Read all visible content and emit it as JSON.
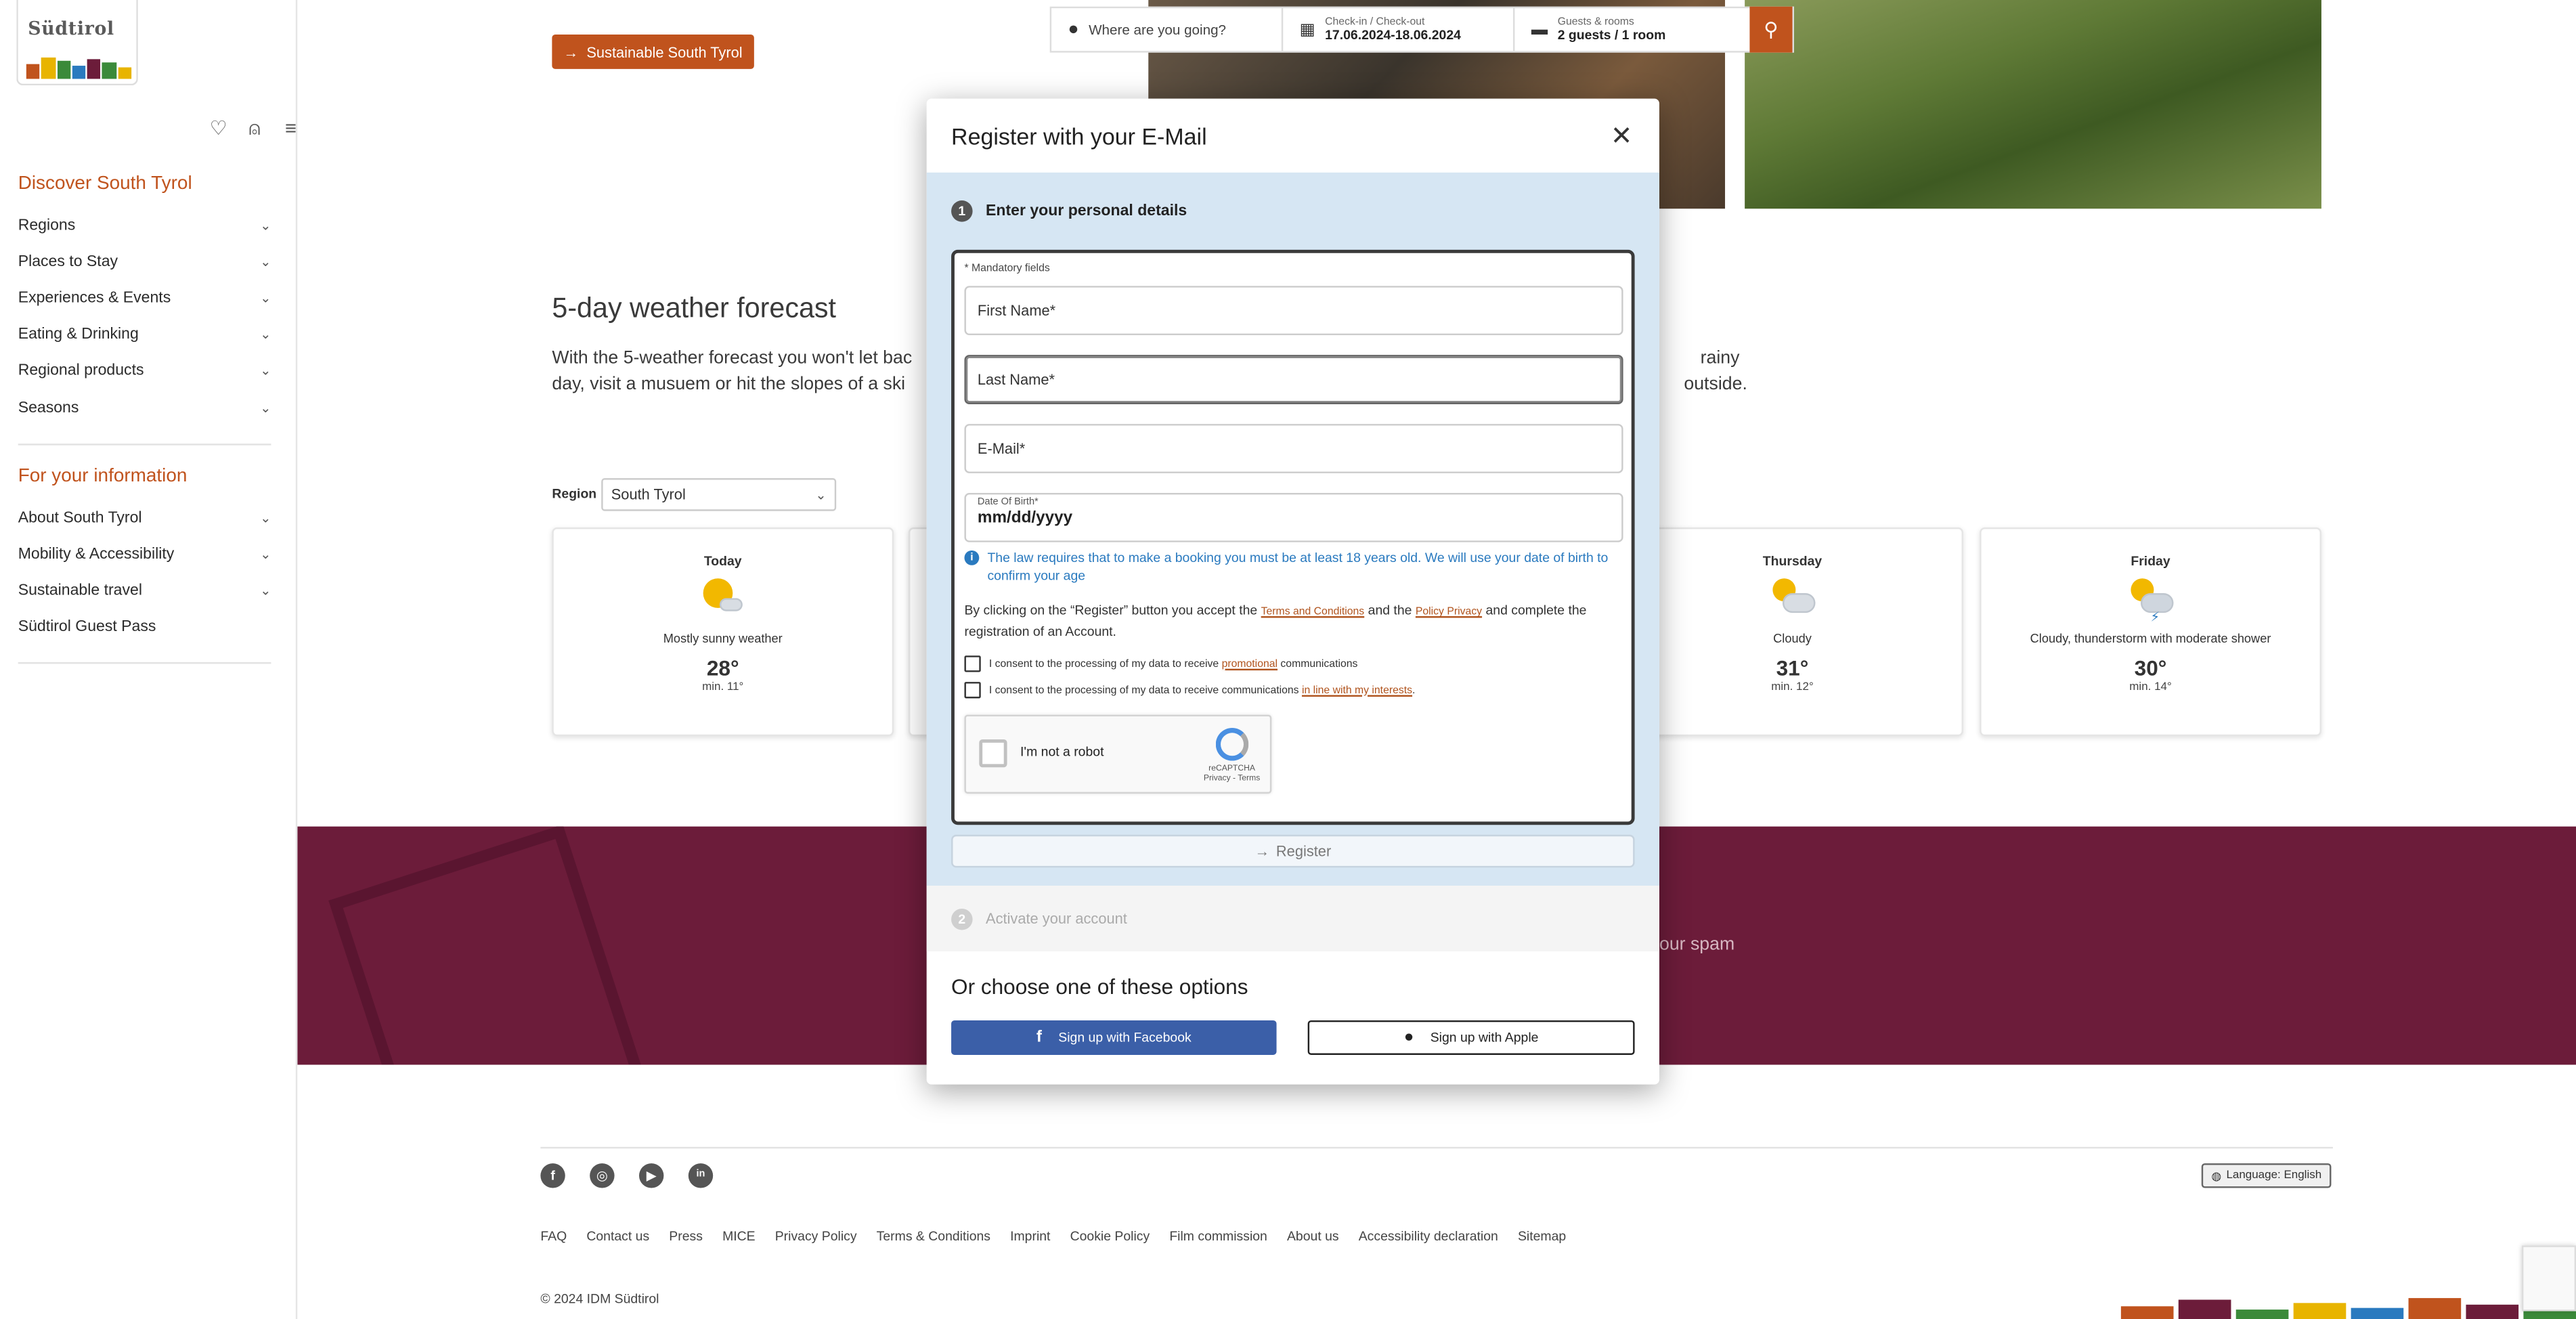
{
  "brand": {
    "logo_text": "Südtirol",
    "colors": {
      "accent": "#c0531d",
      "band": "#6c1c3a",
      "facebook": "#3b5fa8",
      "modal_step_bg": "#d6e6f3",
      "info_blue": "#2a7abf"
    }
  },
  "sidebar": {
    "icons": [
      "heart-icon",
      "user-icon",
      "menu-icon"
    ],
    "section1_title": "Discover South Tyrol",
    "section1_items": [
      {
        "label": "Regions"
      },
      {
        "label": "Places to Stay"
      },
      {
        "label": "Experiences & Events"
      },
      {
        "label": "Eating & Drinking"
      },
      {
        "label": "Regional products"
      },
      {
        "label": "Seasons"
      }
    ],
    "section2_title": "For your information",
    "section2_items": [
      {
        "label": "About South Tyrol",
        "has_chevron": true
      },
      {
        "label": "Mobility & Accessibility",
        "has_chevron": true
      },
      {
        "label": "Sustainable travel",
        "has_chevron": true
      },
      {
        "label": "Südtirol Guest Pass",
        "has_chevron": false
      }
    ]
  },
  "main": {
    "sustainable_button": "Sustainable South Tyrol",
    "search": {
      "destination_placeholder": "Where are you going?",
      "dates_label": "Check-in / Check-out",
      "dates_value": "17.06.2024-18.06.2024",
      "guests_label": "Guests & rooms",
      "guests_value": "2 guests / 1 room"
    },
    "weather": {
      "title": "5-day weather forecast",
      "text_left": "With the 5-weather forecast you won't let bac",
      "text_left2": "day, visit a musuem or hit the slopes of a ski",
      "text_right": "rainy",
      "text_right2": "outside.",
      "region_label": "Region",
      "region_value": "South Tyrol",
      "cards": [
        {
          "day": "Today",
          "desc": "Mostly sunny weather",
          "temp": "28°",
          "min": "min. 11°"
        },
        {
          "day": "Thursday",
          "desc": "Cloudy",
          "temp": "31°",
          "min": "min. 12°"
        },
        {
          "day": "Friday",
          "desc": "Cloudy, thunderstorm with moderate shower",
          "temp": "30°",
          "min": "min. 14°"
        }
      ]
    },
    "newsletter_band_text": "our spam"
  },
  "footer": {
    "social": [
      "f",
      "◎",
      "▶",
      "in"
    ],
    "language_button": "Language: English",
    "links": [
      "FAQ",
      "Contact us",
      "Press",
      "MICE",
      "Privacy Policy",
      "Terms & Conditions",
      "Imprint",
      "Cookie Policy",
      "Film commission",
      "About us",
      "Accessibility declaration",
      "Sitemap"
    ],
    "copyright": "© 2024 IDM Südtirol"
  },
  "modal": {
    "title": "Register with your E-Mail",
    "step1": {
      "number": "1",
      "title": "Enter your personal details",
      "mandatory_note": "* Mandatory fields",
      "first_name_placeholder": "First Name*",
      "last_name_placeholder": "Last Name*",
      "email_placeholder": "E-Mail*",
      "dob_label": "Date Of Birth*",
      "dob_value": "mm/dd/yyyy",
      "info_text": "The law requires that to make a booking you must be at least 18 years old. We will use your date of birth to confirm your age",
      "terms_pre": "By clicking on the “Register” button you accept the",
      "terms_link1": "Terms and Conditions",
      "terms_mid": "and the",
      "terms_link2": "Policy Privacy",
      "terms_post": "and complete the registration of an Account.",
      "consent1_pre": "I consent to the processing of my data to receive",
      "consent1_link": "promotional",
      "consent1_post": "communications",
      "consent2_pre": "I consent to the processing of my data to receive communications",
      "consent2_link": "in line with my interests",
      "consent2_post": ".",
      "captcha_label": "I'm not a robot",
      "captcha_brand": "reCAPTCHA",
      "captcha_links": "Privacy - Terms",
      "register_button": "Register"
    },
    "step2": {
      "number": "2",
      "title": "Activate your account"
    },
    "options_title": "Or choose one of these options",
    "facebook_button": "Sign up with Facebook",
    "apple_button": "Sign up with Apple"
  }
}
